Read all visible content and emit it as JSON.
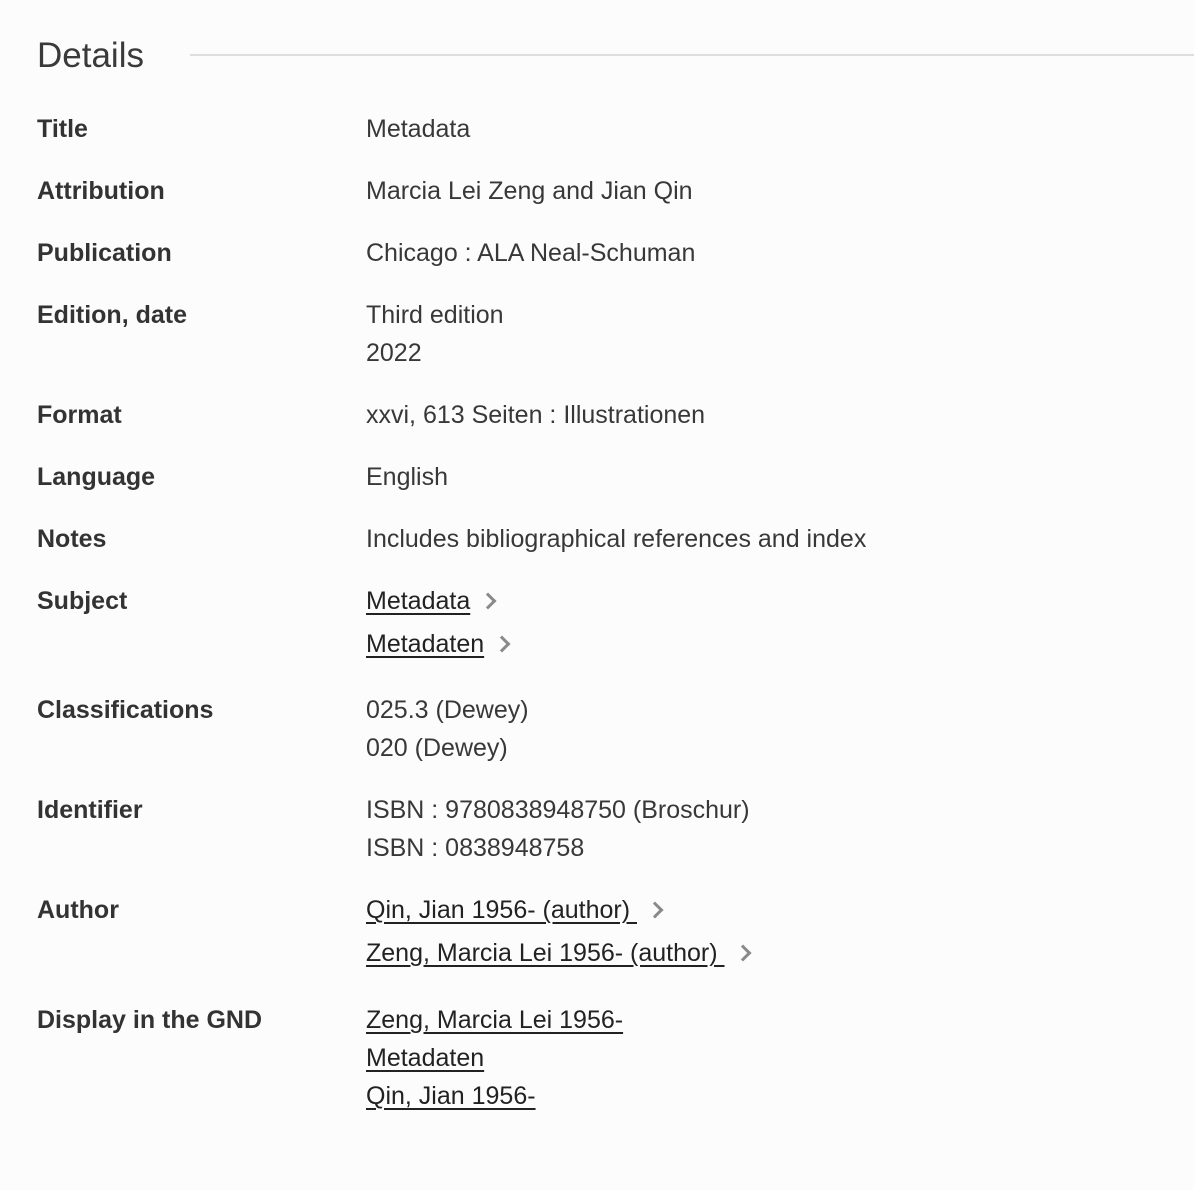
{
  "section": {
    "heading": "Details"
  },
  "fields": {
    "title": {
      "label": "Title",
      "values": [
        "Metadata"
      ]
    },
    "attribution": {
      "label": "Attribution",
      "values": [
        "Marcia Lei Zeng and Jian Qin"
      ]
    },
    "publication": {
      "label": "Publication",
      "values": [
        "Chicago : ALA Neal-Schuman"
      ]
    },
    "edition": {
      "label": "Edition, date",
      "values": [
        "Third edition",
        "2022"
      ]
    },
    "format": {
      "label": "Format",
      "values": [
        "xxvi, 613 Seiten : Illustrationen"
      ]
    },
    "language": {
      "label": "Language",
      "values": [
        "English"
      ]
    },
    "notes": {
      "label": "Notes",
      "values": [
        "Includes bibliographical references and index"
      ]
    },
    "subject": {
      "label": "Subject",
      "links": [
        "Metadata",
        "Metadaten"
      ],
      "link_icon": "chevron-right-icon"
    },
    "classifications": {
      "label": "Classifications",
      "values": [
        "025.3 (Dewey)",
        "020 (Dewey)"
      ]
    },
    "identifier": {
      "label": "Identifier",
      "values": [
        "ISBN : 9780838948750 (Broschur)",
        "ISBN : 0838948758"
      ]
    },
    "author": {
      "label": "Author",
      "links": [
        "Qin, Jian 1956- (author) ",
        "Zeng, Marcia Lei 1956- (author) "
      ],
      "link_icon": "chevron-right-icon"
    },
    "gnd": {
      "label": "Display in the GND",
      "links": [
        "Zeng, Marcia Lei 1956-",
        "Metadaten",
        "Qin, Jian 1956-"
      ]
    }
  }
}
